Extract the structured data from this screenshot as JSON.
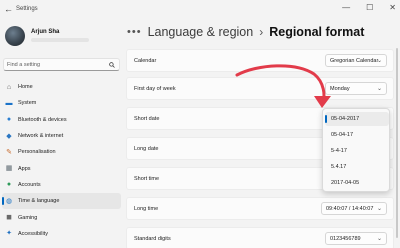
{
  "window": {
    "title": "Settings",
    "back_glyph": "←",
    "controls": [
      "—",
      "☐",
      "✕"
    ]
  },
  "user": {
    "name": "Arjun Sha"
  },
  "search": {
    "placeholder": "Find a setting"
  },
  "nav": {
    "items": [
      {
        "label": "Home",
        "icon": "home-icon",
        "glyph": "⌂",
        "color": "#5a5a5a"
      },
      {
        "label": "System",
        "icon": "monitor-icon",
        "glyph": "▬",
        "color": "#1a73c9"
      },
      {
        "label": "Bluetooth & devices",
        "icon": "bluetooth-icon",
        "glyph": "●",
        "color": "#2a7ed1"
      },
      {
        "label": "Network & internet",
        "icon": "wifi-icon",
        "glyph": "◆",
        "color": "#2b76c2"
      },
      {
        "label": "Personalisation",
        "icon": "brush-icon",
        "glyph": "✎",
        "color": "#c86a2c"
      },
      {
        "label": "Apps",
        "icon": "apps-icon",
        "glyph": "▦",
        "color": "#5c6770"
      },
      {
        "label": "Accounts",
        "icon": "person-icon",
        "glyph": "●",
        "color": "#2f9a5a"
      },
      {
        "label": "Time & language",
        "icon": "globe-clock-icon",
        "glyph": "◍",
        "color": "#1b73c4",
        "selected": true
      },
      {
        "label": "Gaming",
        "icon": "gamepad-icon",
        "glyph": "◼",
        "color": "#6a6a6a"
      },
      {
        "label": "Accessibility",
        "icon": "accessibility-icon",
        "glyph": "✦",
        "color": "#1d6fc0"
      }
    ]
  },
  "header": {
    "dots": "•••",
    "parent": "Language & region",
    "separator": "›",
    "current": "Regional format"
  },
  "rows": [
    {
      "label": "Calendar",
      "value": "Gregorian Calendar"
    },
    {
      "label": "First day of week",
      "value": "Monday"
    },
    {
      "label": "Short date",
      "value": ""
    },
    {
      "label": "Long date",
      "value": ""
    },
    {
      "label": "Short time",
      "value": ""
    },
    {
      "label": "Long time",
      "value": "09:40:07 / 14:40:07"
    },
    {
      "label": "Standard digits",
      "value": "0123456789"
    }
  ],
  "short_date_options": [
    "05-04-2017",
    "05-04-17",
    "5-4-17",
    "5.4.17",
    "2017-04-05"
  ],
  "short_date_selected_index": 0,
  "colors": {
    "accent": "#0067c0",
    "annotation": "#e23b4a"
  }
}
